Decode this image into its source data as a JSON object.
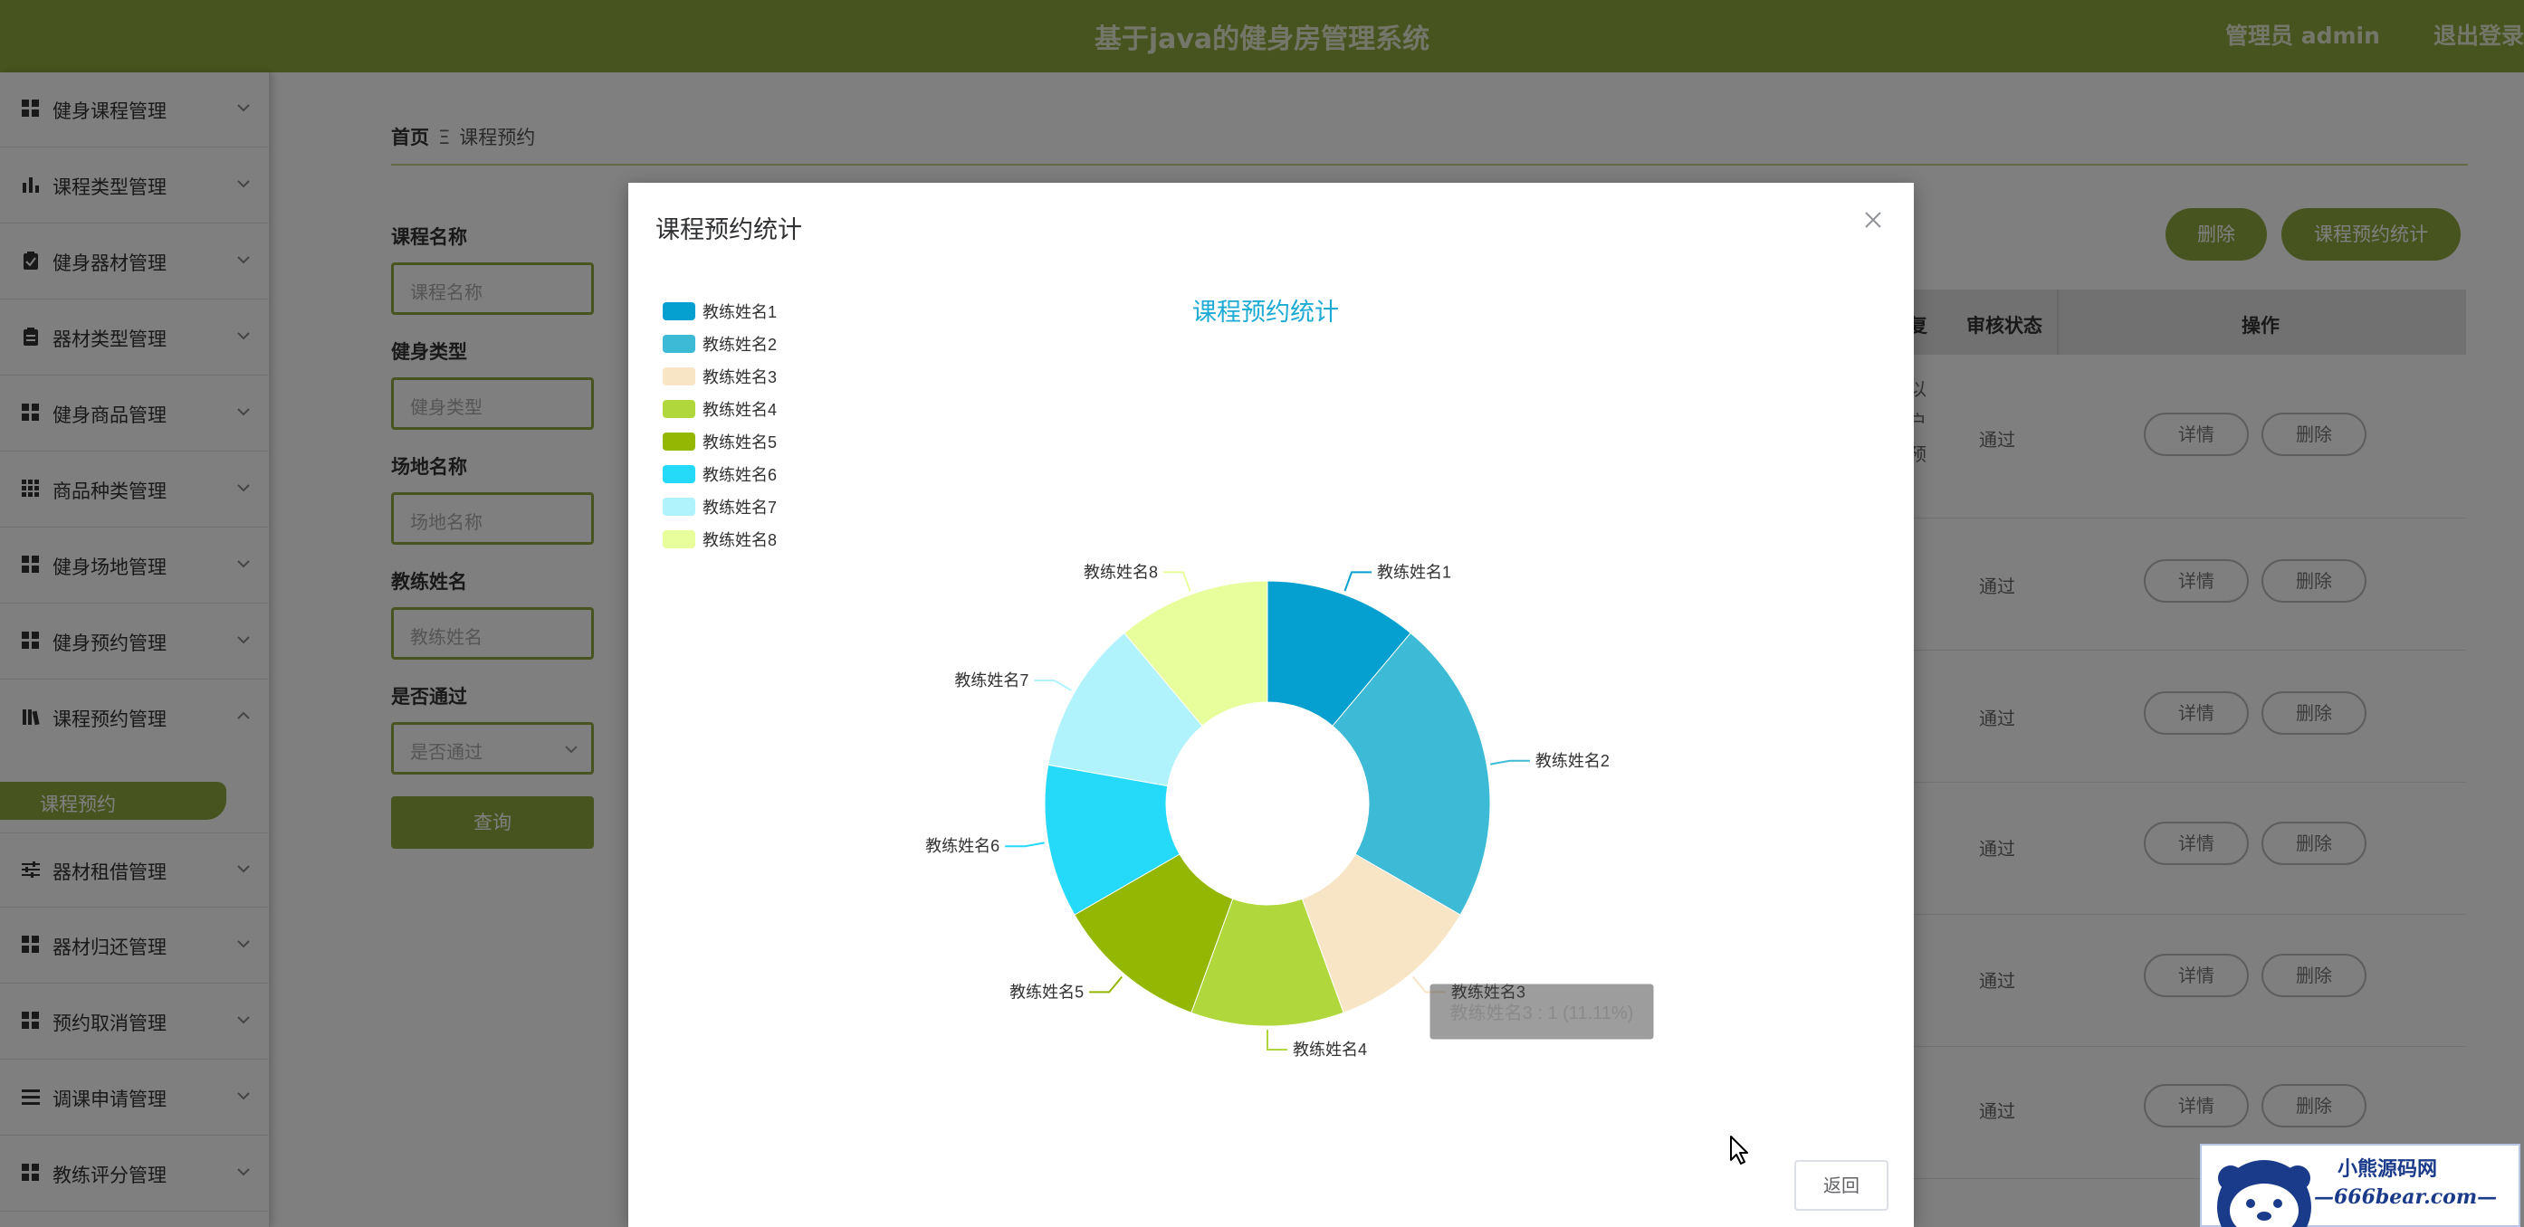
{
  "header": {
    "title": "基于java的健身房管理系统",
    "user": "管理员 admin",
    "logout": "退出登录"
  },
  "sidebar": {
    "items": [
      {
        "label": "健身课程管理",
        "icon": "grid-icon"
      },
      {
        "label": "课程类型管理",
        "icon": "bar-chart-icon"
      },
      {
        "label": "健身器材管理",
        "icon": "clipboard-check-icon"
      },
      {
        "label": "器材类型管理",
        "icon": "clipboard-icon"
      },
      {
        "label": "健身商品管理",
        "icon": "grid-icon"
      },
      {
        "label": "商品种类管理",
        "icon": "grid-dots-icon"
      },
      {
        "label": "健身场地管理",
        "icon": "grid-icon"
      },
      {
        "label": "健身预约管理",
        "icon": "grid-icon"
      },
      {
        "label": "课程预约管理",
        "icon": "library-icon"
      },
      {
        "label": "器材租借管理",
        "icon": "sliders-icon"
      },
      {
        "label": "器材归还管理",
        "icon": "grid-icon"
      },
      {
        "label": "预约取消管理",
        "icon": "grid-icon"
      },
      {
        "label": "调课申请管理",
        "icon": "list-icon"
      },
      {
        "label": "教练评分管理",
        "icon": "grid-icon"
      }
    ],
    "active_sub": "课程预约"
  },
  "breadcrumb": {
    "home": "首页",
    "separator": "Ξ",
    "current": "课程预约"
  },
  "filters": {
    "course_name": {
      "label": "课程名称",
      "placeholder": "课程名称"
    },
    "fitness_type": {
      "label": "健身类型",
      "placeholder": "健身类型"
    },
    "venue_name": {
      "label": "场地名称",
      "placeholder": "场地名称"
    },
    "coach_name": {
      "label": "教练姓名",
      "placeholder": "教练姓名"
    },
    "approved": {
      "label": "是否通过",
      "placeholder": "是否通过"
    },
    "query_label": "查询"
  },
  "actions": {
    "delete_label": "删除",
    "stats_label": "课程预约统计"
  },
  "table": {
    "headers": {
      "partial": "复",
      "status": "审核状态",
      "ops": "操作"
    },
    "row1_fragment": [
      "以",
      "户",
      "预"
    ],
    "rows": [
      {
        "status": "通过",
        "detail": "详情",
        "delete": "删除"
      },
      {
        "status": "通过",
        "detail": "详情",
        "delete": "删除"
      },
      {
        "status": "通过",
        "detail": "详情",
        "delete": "删除"
      },
      {
        "status": "通过",
        "detail": "详情",
        "delete": "删除"
      },
      {
        "status": "通过",
        "detail": "详情",
        "delete": "删除"
      },
      {
        "status": "通过",
        "detail": "详情",
        "delete": "删除"
      }
    ]
  },
  "modal": {
    "title": "课程预约统计",
    "return_label": "返回"
  },
  "chart_data": {
    "type": "pie",
    "title": "课程预约统计",
    "categories": [
      "教练姓名1",
      "教练姓名2",
      "教练姓名3",
      "教练姓名4",
      "教练姓名5",
      "教练姓名6",
      "教练姓名7",
      "教练姓名8"
    ],
    "values": [
      1,
      2,
      1,
      1,
      1,
      1,
      1,
      1
    ],
    "colors": [
      "#05a0d0",
      "#3cbad6",
      "#f7e5c6",
      "#b0d83c",
      "#93b702",
      "#25d9f9",
      "#b1f3fd",
      "#e8fd9c"
    ],
    "legend_position": "top-left",
    "donut": true,
    "tooltip": "教练姓名3 : 1 (11.11%)"
  },
  "watermark": {
    "line1": "小熊源码网",
    "line2": "—666bear.com—"
  }
}
